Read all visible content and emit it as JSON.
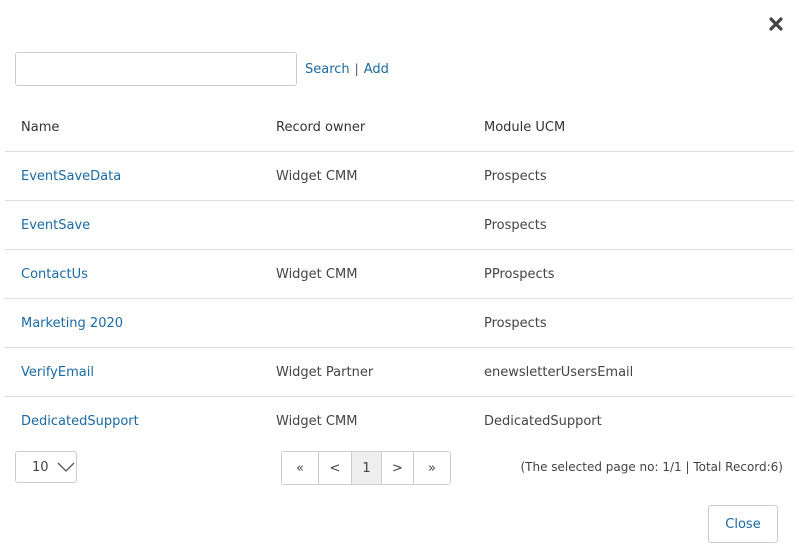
{
  "dialog": {
    "close_icon": "close-icon",
    "close_button_label": "Close"
  },
  "search": {
    "value": "",
    "placeholder": "",
    "search_label": "Search",
    "separator": "|",
    "add_label": "Add"
  },
  "table": {
    "headers": [
      "Name",
      "Record owner",
      "Module UCM"
    ],
    "rows": [
      {
        "name": "EventSaveData",
        "owner": "Widget CMM",
        "module": "Prospects"
      },
      {
        "name": "EventSave",
        "owner": "",
        "module": "Prospects"
      },
      {
        "name": "ContactUs",
        "owner": "Widget CMM",
        "module": "PProspects"
      },
      {
        "name": "Marketing 2020",
        "owner": "",
        "module": "Prospects"
      },
      {
        "name": "VerifyEmail",
        "owner": "Widget Partner",
        "module": "enewsletterUsersEmail"
      },
      {
        "name": "DedicatedSupport",
        "owner": "Widget CMM",
        "module": "DedicatedSupport"
      }
    ]
  },
  "pagination": {
    "page_size": "10",
    "first": "«",
    "prev": "<",
    "current": "1",
    "next": ">",
    "last": "»",
    "info": "(The selected page no: 1/1 | Total Record:6)"
  },
  "colors": {
    "link": "#1a6aa5",
    "border": "#dddddd",
    "active_page_bg": "#eeeeee"
  }
}
